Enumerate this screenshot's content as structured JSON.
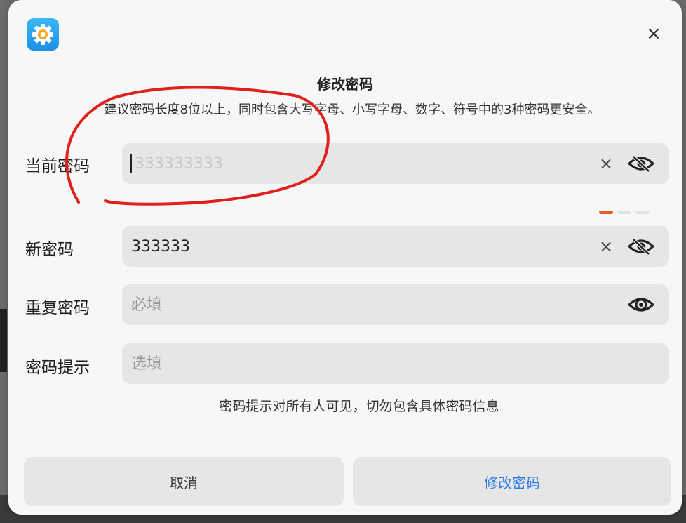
{
  "dialog": {
    "title": "修改密码",
    "description": "建议密码长度8位以上，同时包含大写字母、小写字母、数字、符号中的3种密码更安全。",
    "app_icon": "settings-gear-icon",
    "close_glyph": "×"
  },
  "fields": {
    "current": {
      "label": "当前密码",
      "value": "333333333",
      "clear_glyph": "×",
      "visibility_icon": "eye-slash-icon"
    },
    "new": {
      "label": "新密码",
      "value": "333333",
      "clear_glyph": "×",
      "visibility_icon": "eye-slash-icon",
      "strength_level": 1,
      "strength_max": 3,
      "strength_color": "#ef5a2a"
    },
    "repeat": {
      "label": "重复密码",
      "placeholder": "必填",
      "visibility_icon": "eye-icon"
    },
    "hint": {
      "label": "密码提示",
      "placeholder": "选填",
      "note": "密码提示对所有人可见，切勿包含具体密码信息"
    }
  },
  "buttons": {
    "cancel": "取消",
    "confirm": "修改密码",
    "confirm_color": "#2a7be4"
  },
  "annotation": {
    "color": "#e0201e",
    "shape": "freehand-circle"
  }
}
